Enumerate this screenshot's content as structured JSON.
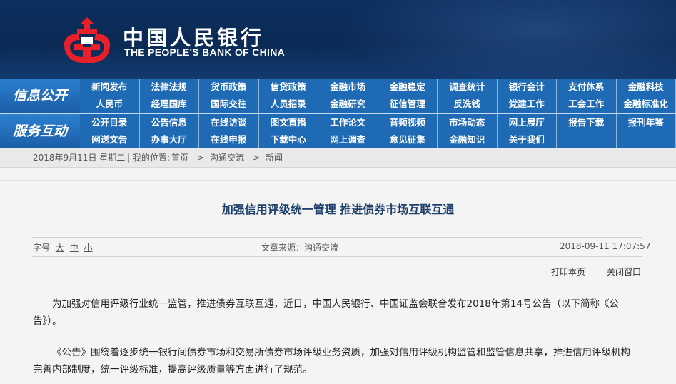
{
  "header": {
    "bank_name_cn": "中国人民银行",
    "bank_name_en": "THE PEOPLE'S BANK OF CHINA",
    "logo_icon": "pboc-logo-icon",
    "logo_color": "#e8202a"
  },
  "nav": {
    "section1_label": "信息公开",
    "section1_items": [
      "新闻发布",
      "法律法规",
      "货币政策",
      "信贷政策",
      "金融市场",
      "金融稳定",
      "调查统计",
      "银行会计",
      "支付体系",
      "金融科技",
      "人民币",
      "经理国库",
      "国际交往",
      "人员招录",
      "金融研究",
      "征信管理",
      "反洗钱",
      "党建工作",
      "工会工作",
      "金融标准化"
    ],
    "section2_label": "服务互动",
    "section2_items": [
      "公开目录",
      "公告信息",
      "在线访谈",
      "图文直播",
      "工作论文",
      "音频视频",
      "市场动态",
      "网上展厅",
      "报告下载",
      "报刊年鉴",
      "网送文告",
      "办事大厅",
      "在线申报",
      "下载中心",
      "网上调查",
      "意见征集",
      "金融知识",
      "关于我们",
      "",
      ""
    ]
  },
  "breadcrumb": {
    "date": "2018年9月11日 星期二",
    "sep": "|",
    "location_label": "我的位置:",
    "home": "首页",
    "arrow": ">",
    "level1": "沟通交流",
    "level2": "新闻"
  },
  "article": {
    "title": "加强信用评级统一管理  推进债券市场互联互通",
    "font_label": "字号",
    "font_large": "大",
    "font_medium": "中",
    "font_small": "小",
    "source": "文章来源：沟通交流",
    "datetime": "2018-09-11  17:07:57",
    "print_label": "打印本页",
    "close_label": "关闭窗口",
    "paragraphs": [
      "为加强对信用评级行业统一监管，推进债券互联互通，近日，中国人民银行、中国证监会联合发布2018年第14号公告（以下简称《公告》）。",
      "《公告》围绕着逐步统一银行间债券市场和交易所债券市场评级业务资质，加强对信用评级机构监管和监管信息共享，推进信用评级机构完善内部制度，统一评级标准，提高评级质量等方面进行了规范。"
    ]
  }
}
